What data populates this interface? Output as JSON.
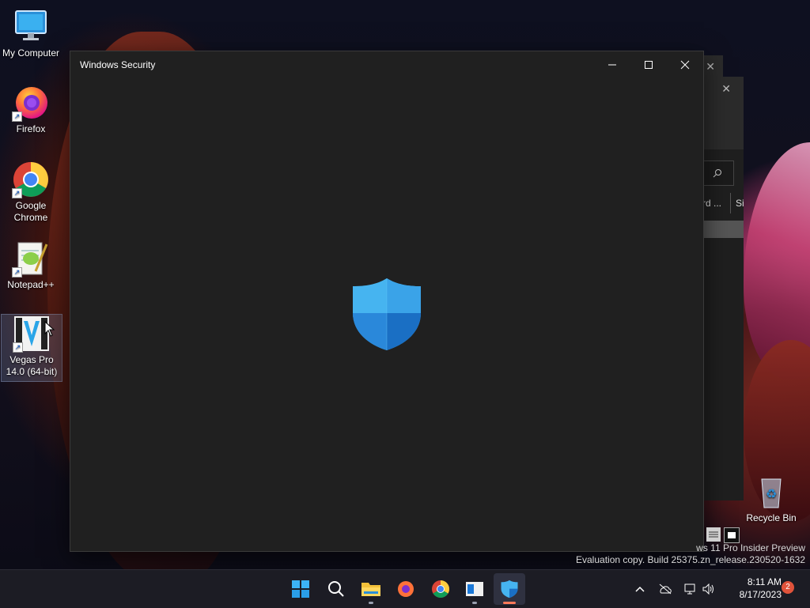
{
  "desktop": {
    "icons": [
      {
        "label": "My Computer"
      },
      {
        "label": "Firefox"
      },
      {
        "label": "Google Chrome"
      },
      {
        "label": "Notepad++"
      },
      {
        "label": "Vegas Pro 14.0 (64-bit)"
      },
      {
        "label": "Recycle Bin"
      }
    ]
  },
  "background_window": {
    "tab_left": "rd ...",
    "tab_right": "Si"
  },
  "window": {
    "title": "Windows Security"
  },
  "watermark": {
    "line1": "ws 11 Pro Insider Preview",
    "line2": "Evaluation copy. Build 25375.zn_release.230520-1632"
  },
  "taskbar": {
    "time": "8:11 AM",
    "date": "8/17/2023",
    "notifications": "2"
  },
  "colors": {
    "accent": "#ff7a5a",
    "shield_light": "#46b4f0",
    "shield_dark": "#1a6fc4"
  }
}
